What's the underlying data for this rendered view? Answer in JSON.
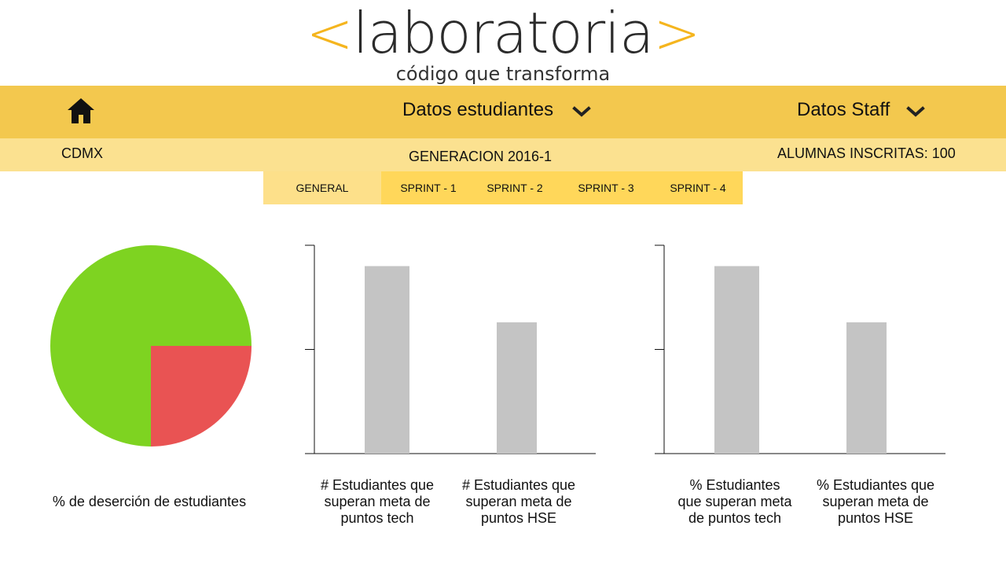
{
  "brand": {
    "open_bracket": "<",
    "name": "laboratoria",
    "close_bracket": ">",
    "tagline": "código que transforma",
    "accent_color": "#f5b51e"
  },
  "nav": {
    "home_icon": "home-icon",
    "items": [
      {
        "label": "Datos estudiantes",
        "icon": "chevron-down-icon"
      },
      {
        "label": "Datos Staff",
        "icon": "chevron-down-icon"
      }
    ],
    "background": "#f3c84e"
  },
  "info": {
    "city": "CDMX",
    "generation": "GENERACION 2016-1",
    "enrolled": "ALUMNAS INSCRITAS: 100"
  },
  "tabs": [
    {
      "label": "GENERAL",
      "active": true
    },
    {
      "label": "SPRINT - 1",
      "active": false
    },
    {
      "label": "SPRINT - 2",
      "active": false
    },
    {
      "label": "SPRINT - 3",
      "active": false
    },
    {
      "label": "SPRINT - 4",
      "active": false
    }
  ],
  "chart_data": [
    {
      "type": "pie",
      "caption": "% de deserción de estudiantes",
      "slices": [
        {
          "label": "",
          "value": 75,
          "color": "#7ed321"
        },
        {
          "label": "",
          "value": 25,
          "color": "#e95353"
        }
      ]
    },
    {
      "type": "bar",
      "categories": [
        "# Estudiantes que superan meta de puntos tech",
        "# Estudiantes que superan meta de puntos HSE"
      ],
      "values": [
        90,
        63
      ],
      "ylim": [
        0,
        100
      ],
      "bar_color": "#c4c4c4"
    },
    {
      "type": "bar",
      "categories": [
        "% Estudiantes que superan meta de puntos tech",
        "% Estudiantes que superan meta de puntos HSE"
      ],
      "values": [
        90,
        63
      ],
      "ylim": [
        0,
        100
      ],
      "bar_color": "#c4c4c4"
    }
  ]
}
